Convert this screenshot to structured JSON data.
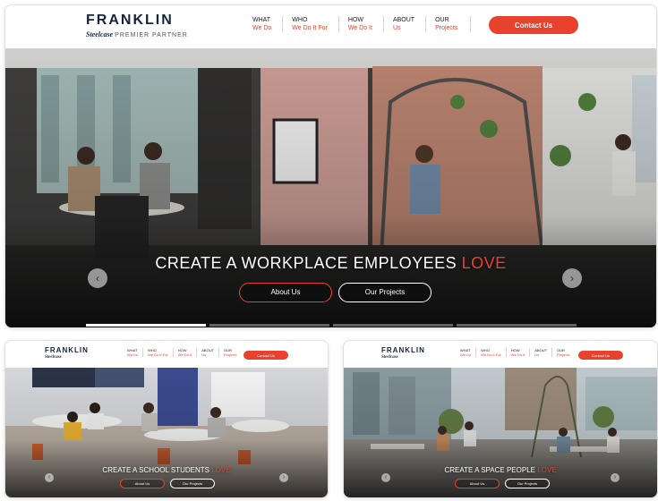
{
  "brand": {
    "name": "FRANKLIN",
    "dealer": "Steelcase",
    "partner_tag": "PREMIER PARTNER",
    "accent_color": "#e8422f",
    "navy_color": "#16233f"
  },
  "nav": [
    {
      "top": "WHAT",
      "bottom": "We Do"
    },
    {
      "top": "WHO",
      "bottom": "We Do It For"
    },
    {
      "top": "HOW",
      "bottom": "We Do It"
    },
    {
      "top": "ABOUT",
      "bottom": "Us"
    },
    {
      "top": "OUR",
      "bottom": "Projects"
    }
  ],
  "contact_button": "Contact Us",
  "main_hero": {
    "headline_prefix": "CREATE A WORKPLACE EMPLOYEES ",
    "headline_accent": "LOVE",
    "about_button": "About Us",
    "projects_button": "Our Projects",
    "prev_icon": "chevron-left-icon",
    "next_icon": "chevron-right-icon",
    "slide_count": 4,
    "active_slide": 1
  },
  "school_hero": {
    "headline_prefix": "CREATE A SCHOOL STUDENTS ",
    "headline_accent": "LOVE",
    "about_button": "About Us",
    "projects_button": "Our Projects"
  },
  "space_hero": {
    "headline_prefix": "CREATE A SPACE PEOPLE ",
    "headline_accent": "LOVE",
    "about_button": "About Us",
    "projects_button": "Our Projects"
  }
}
